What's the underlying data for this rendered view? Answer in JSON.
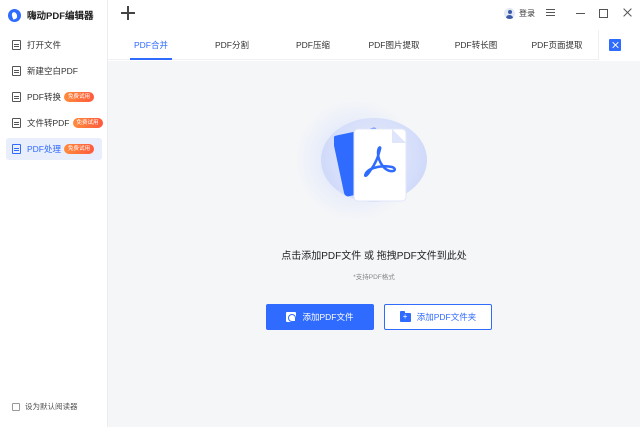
{
  "app": {
    "title": "嗨动PDF编辑器"
  },
  "sidebar": {
    "items": [
      {
        "label": "打开文件",
        "badge": ""
      },
      {
        "label": "新建空白PDF",
        "badge": ""
      },
      {
        "label": "PDF转换",
        "badge": "免费试用"
      },
      {
        "label": "文件转PDF",
        "badge": "免费试用"
      },
      {
        "label": "PDF处理",
        "badge": "免费试用",
        "active": true
      }
    ],
    "default_reader_label": "设为默认阅读器"
  },
  "titlebar": {
    "login_label": "登录"
  },
  "tabs": [
    {
      "label": "PDF合并",
      "active": true
    },
    {
      "label": "PDF分割"
    },
    {
      "label": "PDF压缩"
    },
    {
      "label": "PDF图片提取"
    },
    {
      "label": "PDF转长图"
    },
    {
      "label": "PDF页面提取"
    }
  ],
  "main": {
    "hint": "点击添加PDF文件 或 拖拽PDF文件到此处",
    "sub_hint": "*支持PDF格式",
    "add_file_label": "添加PDF文件",
    "add_folder_label": "添加PDF文件夹"
  },
  "colors": {
    "accent": "#2f6bff",
    "badge": "#ff6a3c",
    "background": "#f5f6f8"
  }
}
